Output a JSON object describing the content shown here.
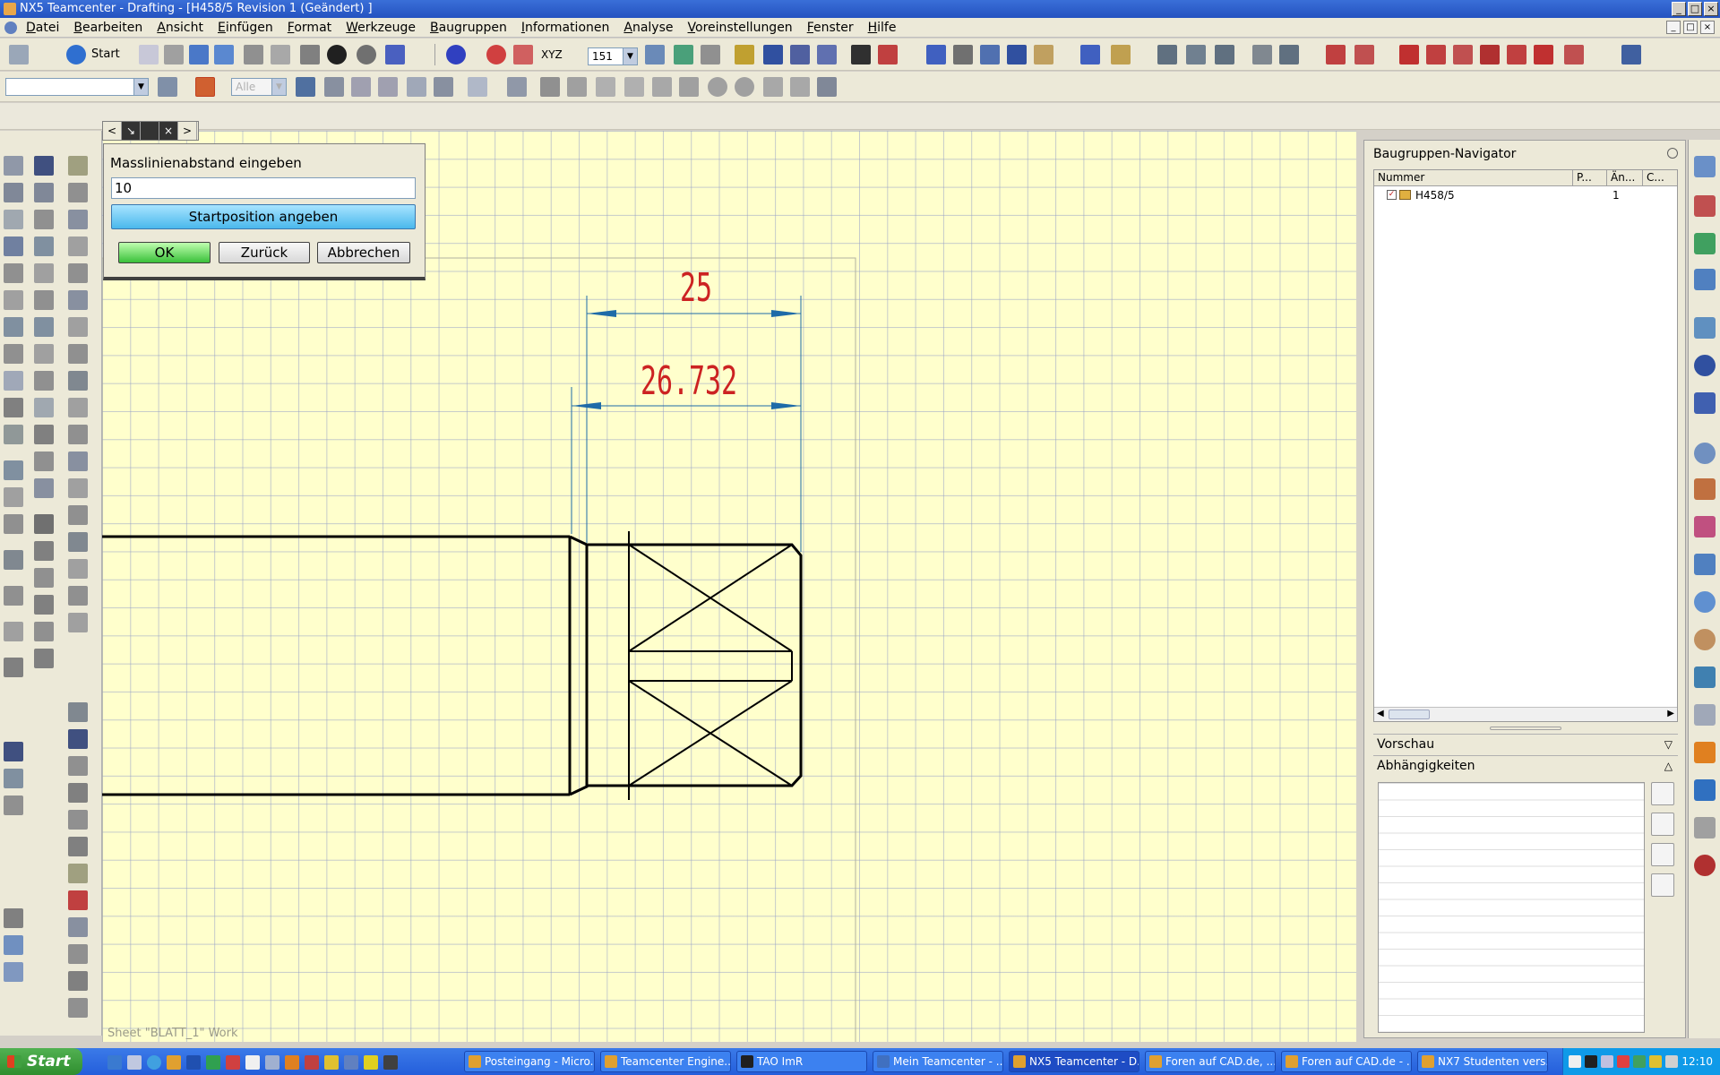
{
  "window": {
    "title": "NX5 Teamcenter - Drafting - [H458/5 Revision 1 (Geändert) ]",
    "controls": [
      "_",
      "□",
      "×"
    ]
  },
  "menubar": {
    "items": [
      "Datei",
      "Bearbeiten",
      "Ansicht",
      "Einfügen",
      "Format",
      "Werkzeuge",
      "Baugruppen",
      "Informationen",
      "Analyse",
      "Voreinstellungen",
      "Fenster",
      "Hilfe"
    ],
    "mdi_controls": [
      "_",
      "□",
      "×"
    ]
  },
  "toolbar": {
    "start_label": "Start",
    "layer_value": "151",
    "filter_value": "Alle",
    "coord_label": "XYZ"
  },
  "dialog": {
    "nav_buttons": [
      "<",
      "↘",
      "×",
      ">"
    ],
    "prompt": "Masslinienabstand eingeben",
    "input_value": "10",
    "primary_action": "Startposition angeben",
    "ok": "OK",
    "back": "Zurück",
    "cancel": "Abbrechen"
  },
  "drawing": {
    "dimension_1": "25",
    "dimension_2": "26.732",
    "dimension_color": "#cc2222",
    "dimension_line_color": "#1e6ba8",
    "geometry_color": "#000000",
    "background": "#ffffcc",
    "sheet_label": "Sheet \"BLATT_1\" Work"
  },
  "navigator": {
    "title": "Baugruppen-Navigator",
    "columns": [
      "Nummer",
      "P...",
      "Än...",
      "C..."
    ],
    "rows": [
      {
        "name": "H458/5",
        "p": "",
        "changes": "1",
        "c": ""
      }
    ],
    "sections": {
      "preview": "Vorschau",
      "dependencies": "Abhängigkeiten"
    }
  },
  "taskbar": {
    "start": "Start",
    "tasks": [
      {
        "label": "Posteingang - Micro...",
        "active": false
      },
      {
        "label": "Teamcenter Engine...",
        "active": false
      },
      {
        "label": "TAO ImR",
        "active": false
      },
      {
        "label": "Mein Teamcenter - ...",
        "active": false
      },
      {
        "label": "NX5 Teamcenter - D...",
        "active": true
      },
      {
        "label": "Foren auf CAD.de, ...",
        "active": false
      },
      {
        "label": "Foren auf CAD.de - ...",
        "active": false
      },
      {
        "label": "NX7 Studenten vers...",
        "active": false
      }
    ],
    "clock": "12:10"
  }
}
